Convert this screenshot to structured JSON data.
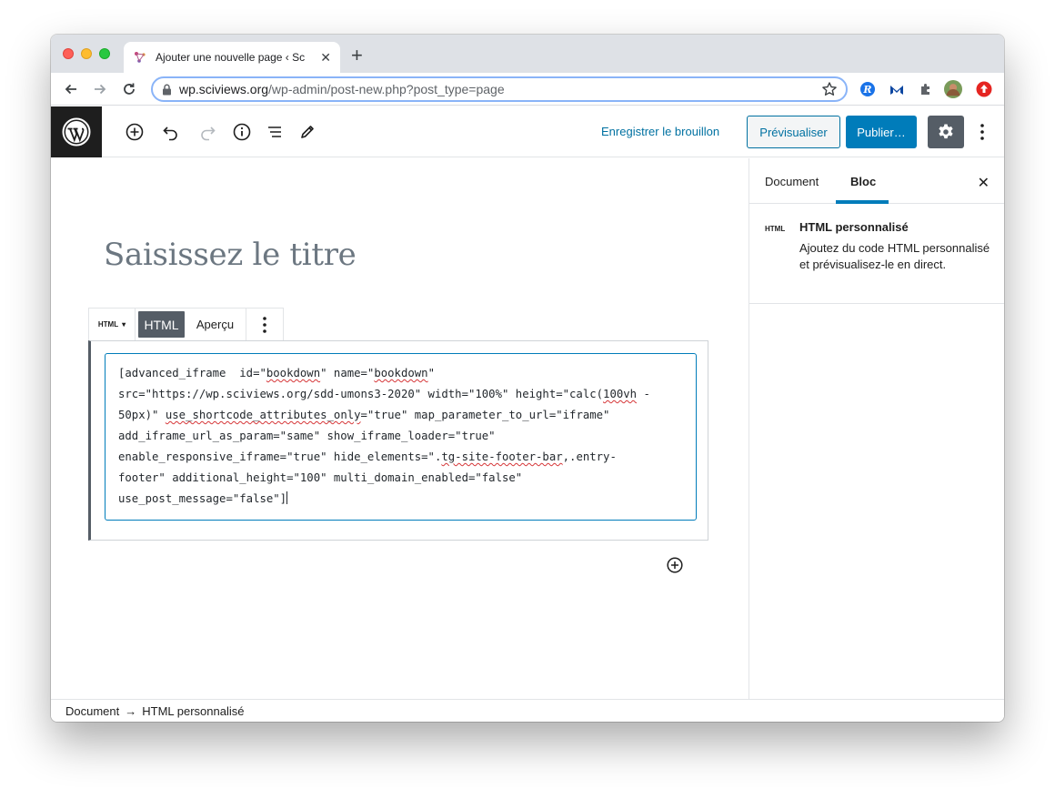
{
  "browser": {
    "tab_title": "Ajouter une nouvelle page ‹ Sc",
    "tab_close": "✕",
    "new_tab": "+",
    "url_host": "wp.sciviews.org",
    "url_path": "/wp-admin/post-new.php?post_type=page"
  },
  "wp_header": {
    "save_draft": "Enregistrer le brouillon",
    "preview": "Prévisualiser",
    "publish": "Publier…"
  },
  "editor": {
    "title_placeholder": "Saisissez le titre",
    "block_switcher_label": "HTML",
    "html_tab": "HTML",
    "preview_tab": "Aperçu",
    "code_lines": [
      "[advanced_iframe  id=\"bookdown\" name=\"bookdown\"",
      "src=\"https://wp.sciviews.org/sdd-umons3-2020\" width=\"100%\" height=\"calc(100vh -",
      "50px)\" use_shortcode_attributes_only=\"true\" map_parameter_to_url=\"iframe\"",
      "add_iframe_url_as_param=\"same\" show_iframe_loader=\"true\"",
      "enable_responsive_iframe=\"true\" hide_elements=\".tg-site-footer-bar,.entry-",
      "footer\" additional_height=\"100\" multi_domain_enabled=\"false\"",
      "use_post_message=\"false\"]"
    ]
  },
  "sidebar": {
    "tab_document": "Document",
    "tab_block": "Bloc",
    "close": "✕",
    "block_icon_label": "HTML",
    "block_title": "HTML personnalisé",
    "block_description": "Ajoutez du code HTML personnalisé et prévisualisez-le en direct."
  },
  "footer": {
    "crumb_root": "Document",
    "crumb_sep": "→",
    "crumb_current": "HTML personnalisé"
  },
  "colors": {
    "accent": "#007cba",
    "link": "#0071a1",
    "wp_dark": "#1e1e1e"
  }
}
